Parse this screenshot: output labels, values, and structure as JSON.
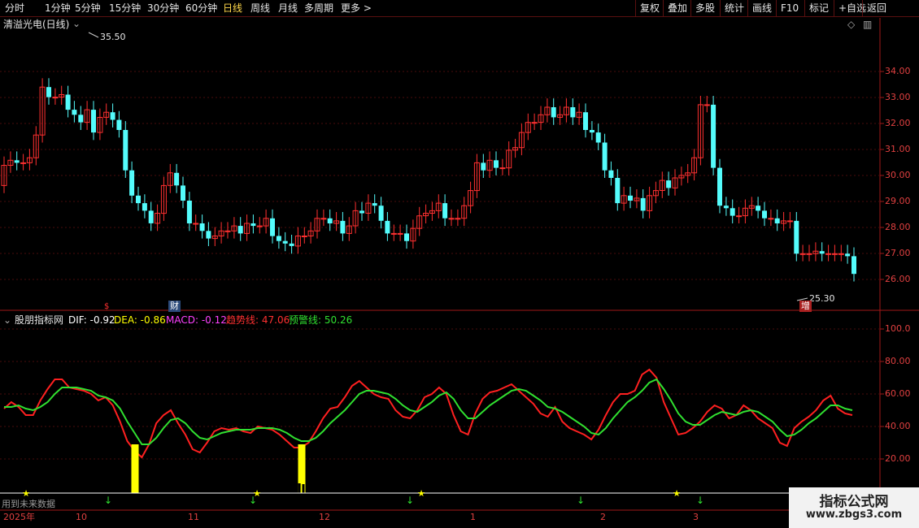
{
  "toolbar": {
    "periods": [
      "分时",
      "1分钟",
      "5分钟",
      "15分钟",
      "30分钟",
      "60分钟",
      "日线",
      "周线",
      "月线",
      "多周期",
      "更多 >"
    ],
    "active": "日线",
    "right": [
      "复权",
      "叠加",
      "多股",
      "统计",
      "画线",
      "F10",
      "标记",
      "+自选",
      "返回"
    ]
  },
  "main_chart": {
    "title": "清溢光电(日线)",
    "high_marker": "35.50",
    "low_marker": "25.30",
    "event_marker_1": "$",
    "event_marker_2": "财",
    "event_marker_3": "增",
    "y_ticks": [
      "34.00",
      "33.00",
      "32.00",
      "31.00",
      "30.00",
      "29.00",
      "28.00",
      "27.00",
      "26.00"
    ]
  },
  "indicator": {
    "name": "股朋指标网",
    "dif_label": "DIF: -0.92",
    "dea_label": "DEA: -0.86",
    "macd_label": "MACD: -0.12",
    "trend_label": "趋势线: 47.06",
    "warn_label": "预警线: 50.26",
    "y_ticks": [
      "100.0",
      "80.00",
      "60.00",
      "40.00",
      "20.00"
    ],
    "footer_note": "用到未来数据"
  },
  "date_axis": [
    "2025年",
    "10",
    "11",
    "12",
    "1",
    "2",
    "3"
  ],
  "watermark": {
    "line1": "指标公式网",
    "line2": "www.zbgs3.com"
  },
  "colors": {
    "up": "#ff3030",
    "down": "#54fcfc",
    "trend": "#ff2020",
    "warn": "#30e030",
    "dif": "#ffffff",
    "dea": "#ffff00",
    "macd": "#ff40ff",
    "signal": "#ffff00"
  },
  "chart_data": [
    {
      "type": "candlestick",
      "title": "清溢光电(日线)",
      "ylim": [
        25.3,
        35.5
      ],
      "open": [
        29.6,
        30.4,
        30.6,
        30.5,
        30.5,
        30.7,
        31.6,
        33.5,
        33.1,
        33.1,
        33.2,
        32.6,
        32.4,
        32.1,
        32.6,
        31.7,
        32.3,
        32.5,
        32.2,
        31.8,
        30.2,
        29.2,
        28.9,
        28.6,
        28.1,
        28.5,
        29.6,
        30.1,
        29.6,
        29.0,
        28.1,
        28.1,
        27.8,
        27.5,
        27.6,
        27.8,
        27.8,
        28.0,
        27.7,
        28.1,
        28.0,
        28.0,
        28.3,
        27.6,
        27.4,
        27.3,
        27.2,
        27.6,
        27.6,
        27.8,
        28.3,
        28.3,
        28.1,
        28.2,
        27.7,
        28.0,
        28.6,
        28.5,
        28.9,
        28.8,
        28.2,
        27.7,
        27.7,
        27.7,
        27.4,
        27.9,
        28.4,
        28.5,
        28.6,
        28.9,
        28.3,
        28.3,
        28.3,
        28.8,
        29.4,
        30.5,
        30.2,
        30.6,
        30.3,
        30.3,
        31.0,
        31.1,
        31.7,
        32.1,
        32.1,
        32.4,
        32.7,
        32.3,
        32.4,
        32.7,
        32.3,
        32.5,
        31.8,
        31.7,
        31.3,
        30.2,
        29.9,
        28.9,
        29.2,
        29.0,
        29.1,
        28.6,
        29.2,
        29.4,
        29.8,
        29.5,
        29.9,
        30.0,
        30.1,
        30.7,
        32.8,
        32.8,
        30.3,
        28.8,
        28.7,
        28.4,
        28.4,
        28.7,
        28.8,
        28.6,
        28.3,
        28.3,
        28.1,
        28.2,
        28.2,
        26.9,
        26.9,
        26.9,
        27.0,
        26.9,
        26.9,
        26.9,
        26.9,
        26.8
      ],
      "close": [
        30.4,
        30.6,
        30.5,
        30.5,
        30.7,
        31.6,
        33.5,
        33.1,
        33.1,
        33.2,
        32.6,
        32.4,
        32.1,
        32.6,
        31.7,
        32.3,
        32.5,
        32.2,
        31.8,
        30.2,
        29.2,
        28.9,
        28.6,
        28.1,
        28.5,
        29.6,
        30.1,
        29.6,
        29.0,
        28.1,
        28.1,
        27.8,
        27.5,
        27.6,
        27.8,
        27.8,
        28.0,
        27.7,
        28.1,
        28.0,
        28.0,
        28.3,
        27.6,
        27.4,
        27.3,
        27.2,
        27.6,
        27.6,
        27.8,
        28.3,
        28.3,
        28.1,
        28.2,
        27.7,
        28.0,
        28.6,
        28.5,
        28.9,
        28.8,
        28.2,
        27.7,
        27.7,
        27.7,
        27.4,
        27.9,
        28.4,
        28.5,
        28.6,
        28.9,
        28.3,
        28.3,
        28.3,
        28.8,
        29.4,
        30.5,
        30.2,
        30.6,
        30.3,
        30.3,
        31.0,
        31.1,
        31.7,
        32.1,
        32.1,
        32.4,
        32.7,
        32.3,
        32.4,
        32.7,
        32.3,
        32.5,
        31.8,
        31.7,
        31.3,
        30.2,
        29.9,
        28.9,
        29.2,
        29.0,
        29.1,
        28.6,
        29.2,
        29.4,
        29.8,
        29.5,
        29.9,
        30.0,
        30.1,
        30.7,
        32.8,
        32.8,
        30.3,
        28.8,
        28.7,
        28.4,
        28.4,
        28.7,
        28.8,
        28.6,
        28.3,
        28.3,
        28.1,
        28.2,
        28.2,
        26.9,
        26.9,
        26.9,
        27.0,
        26.9,
        26.9,
        26.9,
        26.9,
        26.8,
        26.1
      ],
      "dates_axis": [
        "2025年",
        "10",
        "11",
        "12",
        "1",
        "2",
        "3"
      ]
    },
    {
      "type": "line",
      "title": "股朋指标网",
      "ylim": [
        0,
        100
      ],
      "series": [
        {
          "name": "趋势线",
          "values": [
            51,
            55,
            52,
            47,
            47,
            56,
            63,
            69,
            69,
            64,
            63,
            62,
            60,
            56,
            58,
            53,
            43,
            31,
            25,
            21,
            29,
            42,
            47,
            50,
            42,
            35,
            26,
            24,
            30,
            37,
            39,
            38,
            39,
            37,
            36,
            40,
            39,
            38,
            35,
            31,
            27,
            27,
            30,
            37,
            45,
            51,
            52,
            58,
            65,
            68,
            64,
            60,
            58,
            57,
            50,
            46,
            45,
            50,
            58,
            60,
            64,
            60,
            47,
            37,
            35,
            48,
            57,
            61,
            62,
            64,
            66,
            62,
            58,
            54,
            48,
            46,
            52,
            43,
            39,
            37,
            35,
            32,
            38,
            47,
            55,
            60,
            60,
            62,
            72,
            75,
            70,
            55,
            45,
            35,
            36,
            39,
            43,
            49,
            53,
            51,
            45,
            47,
            53,
            50,
            45,
            42,
            39,
            30,
            28,
            39,
            43,
            46,
            50,
            56,
            59,
            51,
            48,
            47
          ]
        },
        {
          "name": "预警线",
          "values": [
            52,
            52,
            53,
            51,
            50,
            52,
            55,
            60,
            64,
            64,
            64,
            63,
            62,
            59,
            58,
            56,
            51,
            43,
            36,
            29,
            29,
            33,
            39,
            44,
            45,
            42,
            37,
            33,
            32,
            34,
            36,
            37,
            38,
            38,
            38,
            39,
            39,
            39,
            38,
            36,
            33,
            31,
            31,
            33,
            37,
            42,
            46,
            50,
            55,
            60,
            62,
            62,
            61,
            60,
            57,
            53,
            50,
            49,
            52,
            55,
            59,
            61,
            57,
            50,
            45,
            45,
            49,
            53,
            56,
            59,
            62,
            63,
            62,
            59,
            56,
            52,
            51,
            49,
            46,
            43,
            40,
            36,
            35,
            39,
            45,
            50,
            55,
            58,
            62,
            67,
            69,
            63,
            56,
            48,
            43,
            41,
            41,
            44,
            47,
            49,
            48,
            47,
            49,
            50,
            49,
            46,
            43,
            38,
            34,
            35,
            38,
            42,
            45,
            49,
            53,
            53,
            51,
            50
          ]
        }
      ]
    }
  ]
}
